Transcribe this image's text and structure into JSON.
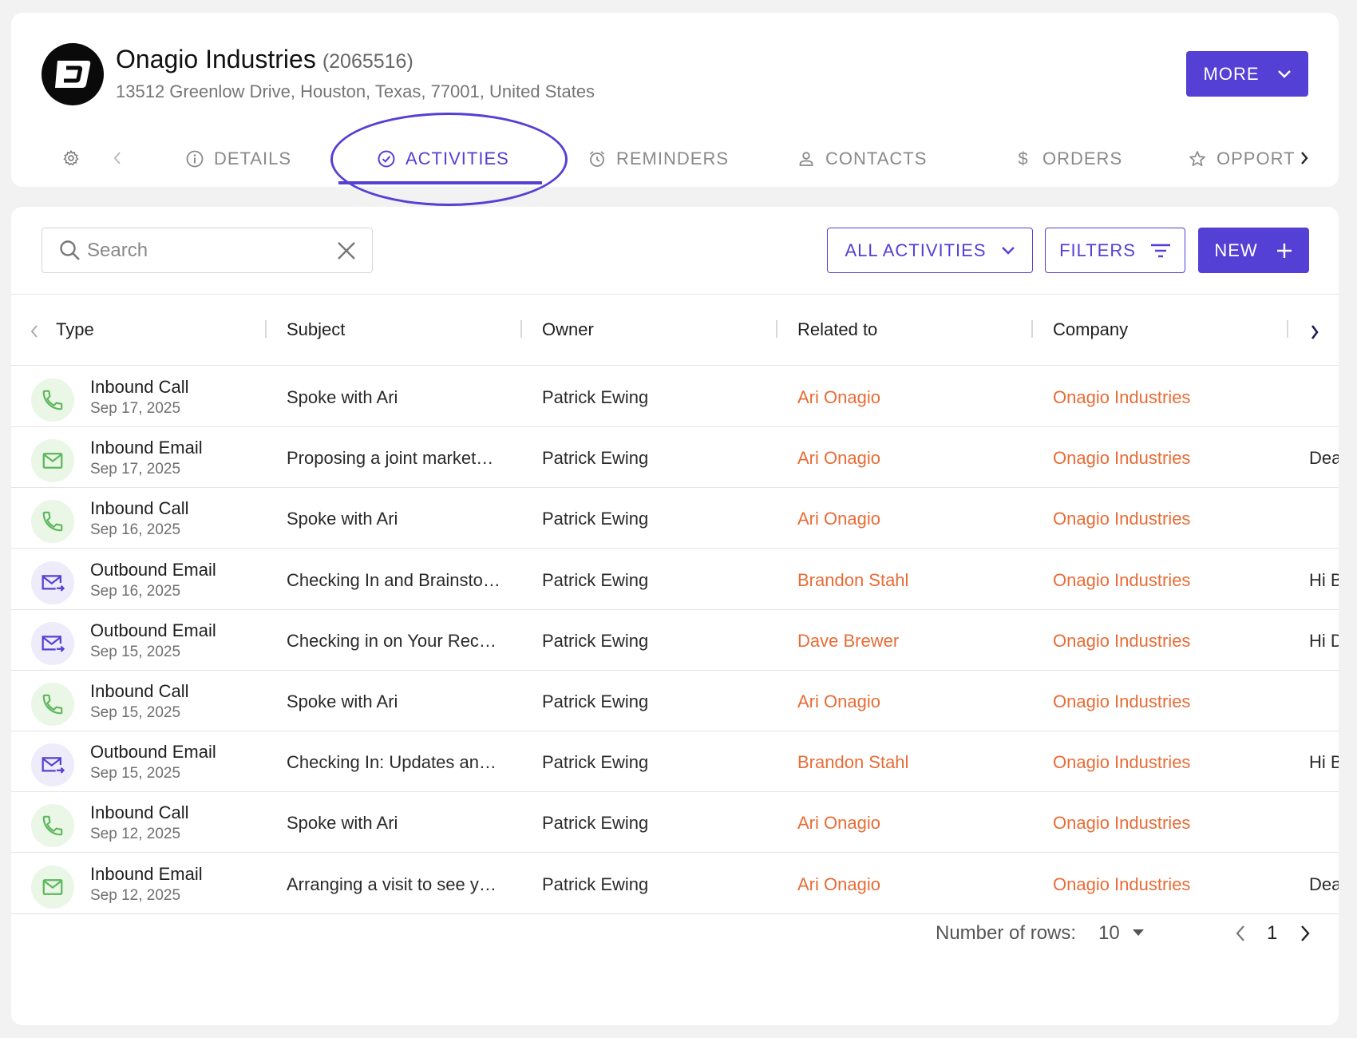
{
  "company": {
    "name": "Onagio Industries",
    "id": "(2065516)",
    "address": "13512 Greenlow Drive, Houston, Texas, 77001, United States",
    "logo_icon": "onagio-logo-icon"
  },
  "header": {
    "more_label": "MORE"
  },
  "tabs": [
    {
      "label": "DETAILS",
      "icon": "info-icon"
    },
    {
      "label": "ACTIVITIES",
      "icon": "check-circle-icon",
      "active": true
    },
    {
      "label": "REMINDERS",
      "icon": "alarm-clock-icon"
    },
    {
      "label": "CONTACTS",
      "icon": "person-icon"
    },
    {
      "label": "ORDERS",
      "icon": "dollar-icon"
    },
    {
      "label": "OPPORT",
      "icon": "star-icon"
    }
  ],
  "toolbar": {
    "search_placeholder": "Search",
    "all_activities_label": "ALL ACTIVITIES",
    "filters_label": "FILTERS",
    "new_label": "NEW"
  },
  "table": {
    "columns": [
      "Type",
      "Subject",
      "Owner",
      "Related to",
      "Company"
    ],
    "rows": [
      {
        "type": "Inbound Call",
        "kind": "call",
        "date": "Sep 17, 2025",
        "subject": "Spoke with Ari",
        "owner": "Patrick Ewing",
        "related": "Ari Onagio",
        "company": "Onagio Industries",
        "extra": ""
      },
      {
        "type": "Inbound Email",
        "kind": "email-in",
        "date": "Sep 17, 2025",
        "subject": "Proposing a joint market…",
        "owner": "Patrick Ewing",
        "related": "Ari Onagio",
        "company": "Onagio Industries",
        "extra": "Dea"
      },
      {
        "type": "Inbound Call",
        "kind": "call",
        "date": "Sep 16, 2025",
        "subject": "Spoke with Ari",
        "owner": "Patrick Ewing",
        "related": "Ari Onagio",
        "company": "Onagio Industries",
        "extra": ""
      },
      {
        "type": "Outbound Email",
        "kind": "email-out",
        "date": "Sep 16, 2025",
        "subject": "Checking In and Brainsto…",
        "owner": "Patrick Ewing",
        "related": "Brandon Stahl",
        "company": "Onagio Industries",
        "extra": "Hi B"
      },
      {
        "type": "Outbound Email",
        "kind": "email-out",
        "date": "Sep 15, 2025",
        "subject": "Checking in on Your Rec…",
        "owner": "Patrick Ewing",
        "related": "Dave Brewer",
        "company": "Onagio Industries",
        "extra": "Hi D"
      },
      {
        "type": "Inbound Call",
        "kind": "call",
        "date": "Sep 15, 2025",
        "subject": "Spoke with Ari",
        "owner": "Patrick Ewing",
        "related": "Ari Onagio",
        "company": "Onagio Industries",
        "extra": ""
      },
      {
        "type": "Outbound Email",
        "kind": "email-out",
        "date": "Sep 15, 2025",
        "subject": "Checking In: Updates an…",
        "owner": "Patrick Ewing",
        "related": "Brandon Stahl",
        "company": "Onagio Industries",
        "extra": "Hi B"
      },
      {
        "type": "Inbound Call",
        "kind": "call",
        "date": "Sep 12, 2025",
        "subject": "Spoke with Ari",
        "owner": "Patrick Ewing",
        "related": "Ari Onagio",
        "company": "Onagio Industries",
        "extra": ""
      },
      {
        "type": "Inbound Email",
        "kind": "email-in",
        "date": "Sep 12, 2025",
        "subject": "Arranging a visit to see y…",
        "owner": "Patrick Ewing",
        "related": "Ari Onagio",
        "company": "Onagio Industries",
        "extra": "Dea"
      }
    ]
  },
  "pagination": {
    "rows_label": "Number of rows:",
    "rows_value": "10",
    "page": "1"
  },
  "colors": {
    "accent": "#5440d4",
    "link": "#e86c36",
    "call_icon": "#5cb85c",
    "email_in_icon": "#5cb85c",
    "email_out_icon": "#5440d4"
  }
}
